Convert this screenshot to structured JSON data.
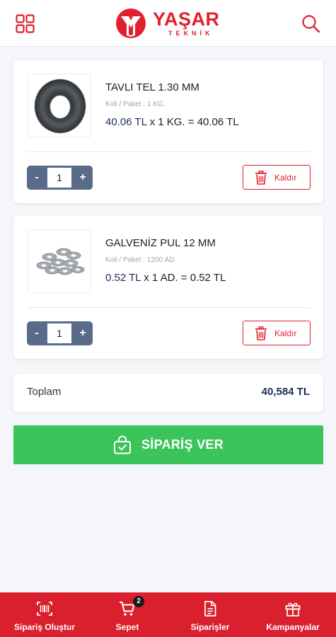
{
  "brand": {
    "name": "YAŞAR",
    "subtitle": "TEKNİK",
    "color": "#e1202e"
  },
  "header": {
    "menu_icon": "grid-icon",
    "search_icon": "search-icon"
  },
  "cart": {
    "items": [
      {
        "name": "TAVLI TEL 1.30 MM",
        "pack": "Koli / Paket : 1 KG.",
        "unit_price": "40.06 TL",
        "qty_expr": "x 1 KG. =",
        "line_total": "40.06 TL",
        "quantity": "1",
        "minus_label": "-",
        "plus_label": "+",
        "remove_label": "Kaldır",
        "image": "wire-coil"
      },
      {
        "name": "GALVENİZ PUL 12 MM",
        "pack": "Koli / Paket : 1200 AD.",
        "unit_price": "0.52 TL",
        "qty_expr": "x 1 AD. =",
        "line_total": "0.52 TL",
        "quantity": "1",
        "minus_label": "-",
        "plus_label": "+",
        "remove_label": "Kaldır",
        "image": "washers"
      }
    ],
    "total_label": "Toplam",
    "total_value": "40,584 TL"
  },
  "order_button": {
    "label": "SİPARİŞ VER",
    "icon": "shopping-bag-check-icon",
    "color": "#3bc45a"
  },
  "tabbar": {
    "color": "#da1f2e",
    "tabs": [
      {
        "label": "Sipariş Oluştur",
        "icon": "barcode-scan-icon"
      },
      {
        "label": "Sepet",
        "icon": "cart-icon",
        "badge": "2"
      },
      {
        "label": "Siparişler",
        "icon": "document-icon"
      },
      {
        "label": "Kampanyalar",
        "icon": "gift-icon"
      }
    ]
  }
}
